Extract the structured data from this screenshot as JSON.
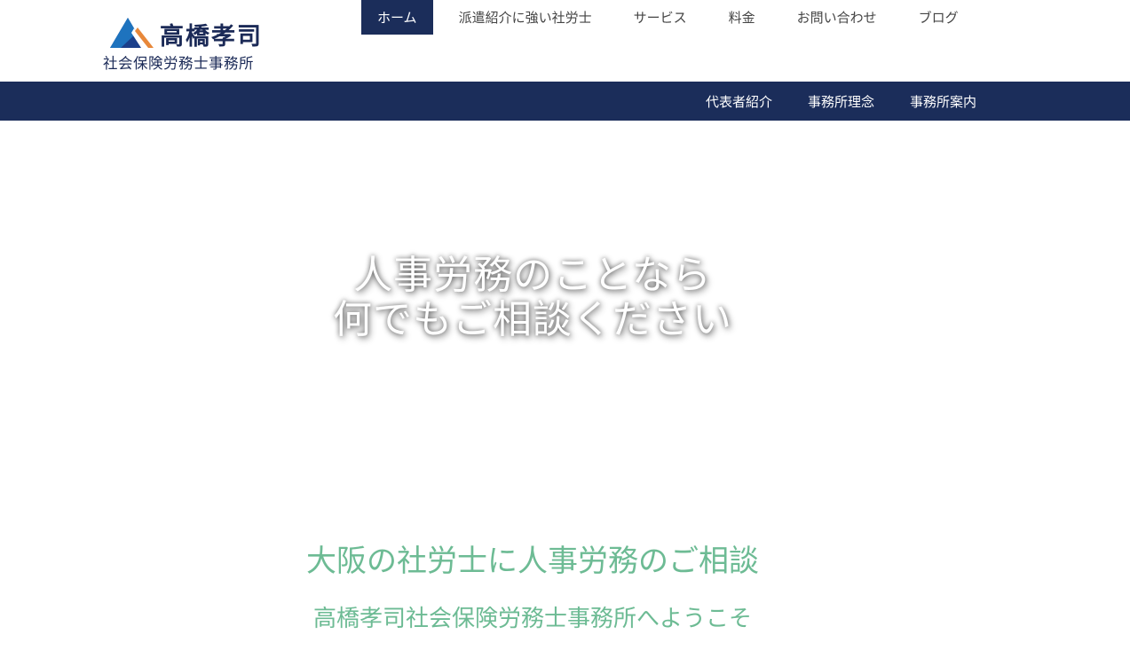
{
  "header": {
    "logo": {
      "name": "高橋孝司",
      "subtitle": "社会保険労務士事務所"
    },
    "main_nav": [
      {
        "label": "ホーム",
        "active": true
      },
      {
        "label": "派遣紹介に強い社労士",
        "active": false
      },
      {
        "label": "サービス",
        "active": false
      },
      {
        "label": "料金",
        "active": false
      },
      {
        "label": "お問い合わせ",
        "active": false
      },
      {
        "label": "ブログ",
        "active": false
      }
    ],
    "sub_nav": [
      {
        "label": "代表者紹介"
      },
      {
        "label": "事務所理念"
      },
      {
        "label": "事務所案内"
      }
    ]
  },
  "hero": {
    "line1": "人事労務のことなら",
    "line2": "何でもご相談ください"
  },
  "intro": {
    "heading": "大阪の社労士に人事労務のご相談",
    "subheading": "高橋孝司社会保険労務士事務所へようこそ"
  },
  "colors": {
    "navy": "#1b2d5a",
    "accent_green": "#6dbb94",
    "logo_blue": "#1e73be",
    "logo_orange": "#e8883a"
  }
}
